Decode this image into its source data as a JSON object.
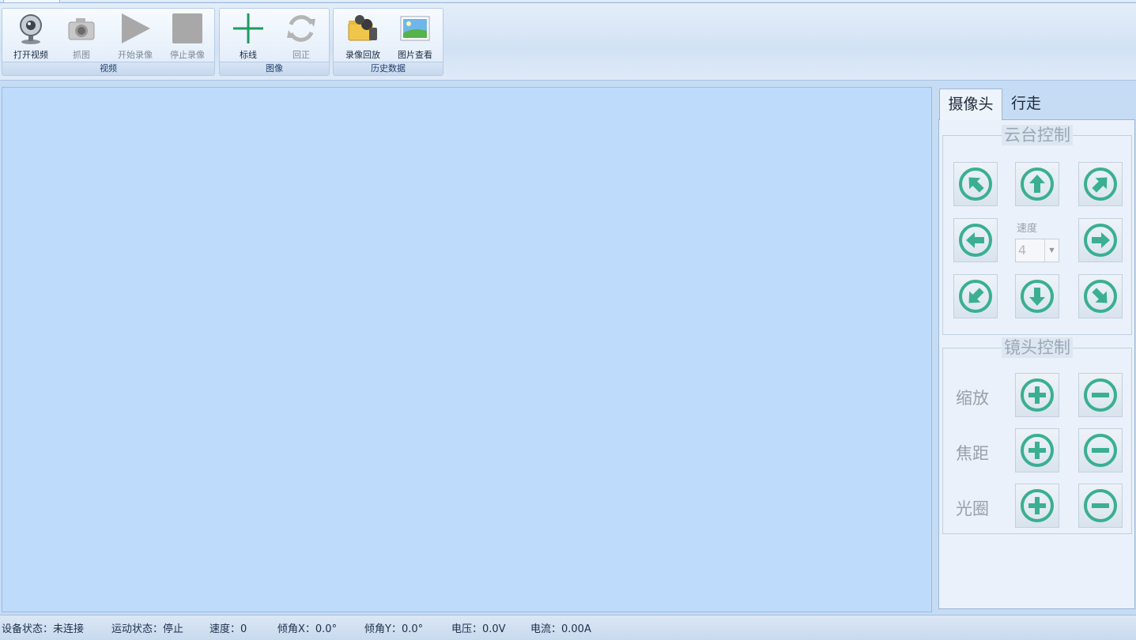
{
  "ribbon": {
    "groups": [
      {
        "label": "视频",
        "buttons": [
          {
            "label": "打开视频"
          },
          {
            "label": "抓图"
          },
          {
            "label": "开始录像"
          },
          {
            "label": "停止录像"
          }
        ]
      },
      {
        "label": "图像",
        "buttons": [
          {
            "label": "标线"
          },
          {
            "label": "回正"
          }
        ]
      },
      {
        "label": "历史数据",
        "buttons": [
          {
            "label": "录像回放"
          },
          {
            "label": "图片查看"
          }
        ]
      }
    ]
  },
  "side": {
    "tabs": [
      {
        "label": "摄像头",
        "active": true
      },
      {
        "label": "行走",
        "active": false
      }
    ],
    "ptz": {
      "title": "云台控制",
      "speed_label": "速度",
      "speed_value": "4"
    },
    "lens": {
      "title": "镜头控制",
      "rows": [
        {
          "label": "缩放"
        },
        {
          "label": "焦距"
        },
        {
          "label": "光圈"
        }
      ]
    }
  },
  "status": {
    "device": "设备状态：未连接",
    "motion": "运动状态：停止",
    "speed": "速度：0",
    "tilt_x": "倾角X：0.0°",
    "tilt_y": "倾角Y：0.0°",
    "voltage": "电压：0.0V",
    "current": "电流：0.00A"
  },
  "colors": {
    "accent_green": "#3aaf92",
    "video_bg": "#bedbfc",
    "panel_bg": "#eaf1fa"
  },
  "icons": {
    "ptz": [
      "arrow-up-left-icon",
      "arrow-up-icon",
      "arrow-up-right-icon",
      "arrow-left-icon",
      "arrow-right-icon",
      "arrow-down-left-icon",
      "arrow-down-icon",
      "arrow-down-right-icon"
    ],
    "lens": [
      "plus-icon",
      "minus-icon"
    ]
  }
}
